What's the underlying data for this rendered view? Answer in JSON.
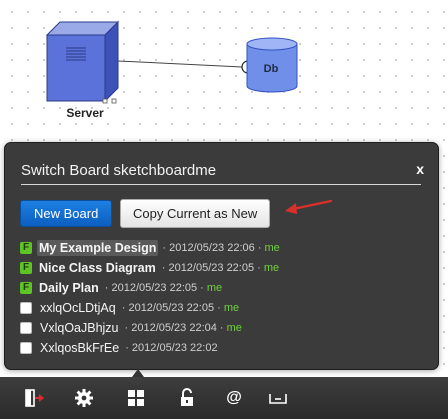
{
  "canvas": {
    "server_label": "Server",
    "db_label": "Db"
  },
  "dialog": {
    "title": "Switch Board sketchboardme",
    "close_label": "x",
    "new_board_label": "New Board",
    "copy_label": "Copy Current as New",
    "accent_color": "#0b6fd9",
    "annotation_color": "#d9302c",
    "designs": [
      {
        "name": "My Example Design",
        "date": "· 2012/05/23 22:06 ·",
        "owner": "me",
        "icon": "flag-f-icon",
        "selected": true
      },
      {
        "name": "Nice Class Diagram",
        "date": "· 2012/05/23 22:05 ·",
        "owner": "me",
        "icon": "flag-f-icon",
        "selected": false
      },
      {
        "name": "Daily Plan",
        "date": "· 2012/05/23 22:05 ·",
        "owner": "me",
        "icon": "flag-f-icon",
        "selected": false
      },
      {
        "name": "xxlqOcLDtjAq",
        "date": "· 2012/05/23 22:05 ·",
        "owner": "me",
        "icon": "checkbox-icon",
        "selected": false
      },
      {
        "name": "VxlqOaJBhjzu",
        "date": "· 2012/05/23 22:04 ·",
        "owner": "me",
        "icon": "checkbox-icon",
        "selected": false
      },
      {
        "name": "XxlqosBkFrEe",
        "date": "· 2012/05/23 22:02",
        "owner": "",
        "icon": "checkbox-icon",
        "selected": false
      }
    ],
    "flag_letter": "F"
  },
  "toolbar": {
    "items": [
      "exit-icon",
      "gear-icon",
      "grid-icon",
      "lock-icon",
      "at-icon",
      "tray-icon"
    ],
    "at_label": "@"
  }
}
